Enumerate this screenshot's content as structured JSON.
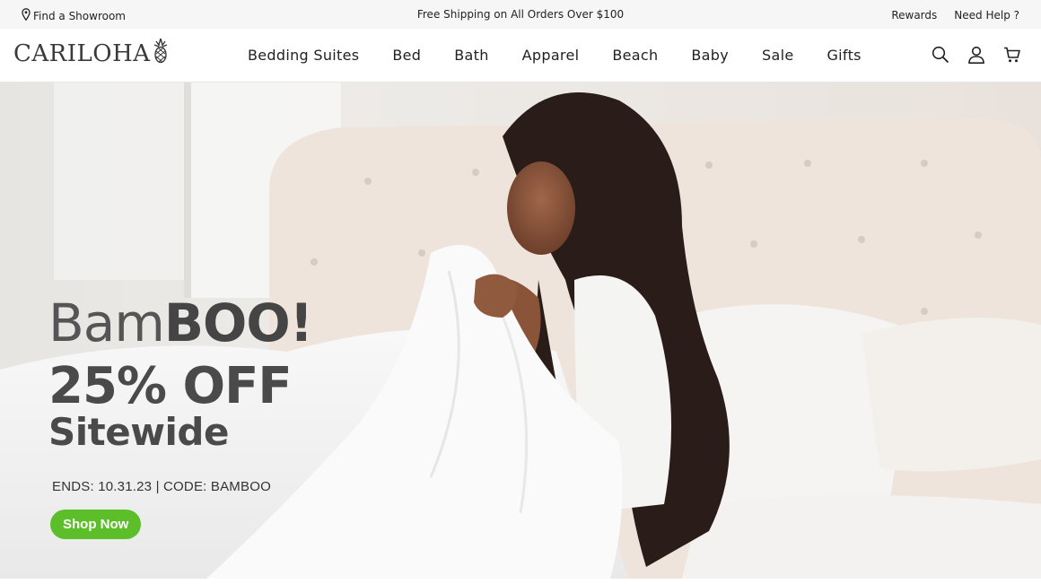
{
  "topbar": {
    "showroom_label": "Find a Showroom",
    "shipping_text": "Free Shipping on All Orders Over $100",
    "rewards_label": "Rewards",
    "help_label": "Need Help ?"
  },
  "header": {
    "logo_text": "CARILOHA",
    "nav": [
      {
        "label": "Bedding Suites"
      },
      {
        "label": "Bed"
      },
      {
        "label": "Bath"
      },
      {
        "label": "Apparel"
      },
      {
        "label": "Beach"
      },
      {
        "label": "Baby"
      },
      {
        "label": "Sale"
      },
      {
        "label": "Gifts"
      }
    ],
    "icons": [
      "search-icon",
      "account-icon",
      "cart-icon"
    ]
  },
  "hero": {
    "headline_light": "Bam",
    "headline_bold": "BOO!",
    "discount": "25% OFF",
    "sitewide": "Sitewide",
    "ends_text": "ENDS: 10.31.23 | CODE: BAMBOO",
    "cta_label": "Shop Now",
    "cta_color": "#5cbf2a"
  }
}
